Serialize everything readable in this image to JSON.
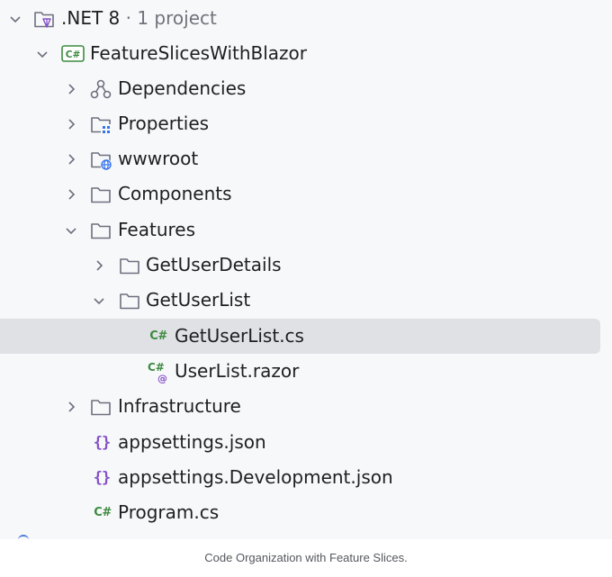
{
  "solution": {
    "name": ".NET 8",
    "suffix": " · 1 project"
  },
  "tree": {
    "project": "FeatureSlicesWithBlazor",
    "dependencies": "Dependencies",
    "properties": "Properties",
    "wwwroot": "wwwroot",
    "components": "Components",
    "features": "Features",
    "get_user_details": "GetUserDetails",
    "get_user_list": "GetUserList",
    "get_user_list_cs": "GetUserList.cs",
    "user_list_razor": "UserList.razor",
    "infrastructure": "Infrastructure",
    "appsettings": "appsettings.json",
    "appsettings_dev": "appsettings.Development.json",
    "program": "Program.cs"
  },
  "icons": {
    "csharp_badge": "C#",
    "json_glyph": "{}",
    "razor_at": "@"
  },
  "selected_item": "GetUserList.cs",
  "colors": {
    "selection": "#dfe1e5",
    "csharp_green": "#3d8a3f",
    "json_purple": "#8552c7",
    "folder_stroke": "#6c707e"
  },
  "caption": "Code Organization with Feature Slices."
}
